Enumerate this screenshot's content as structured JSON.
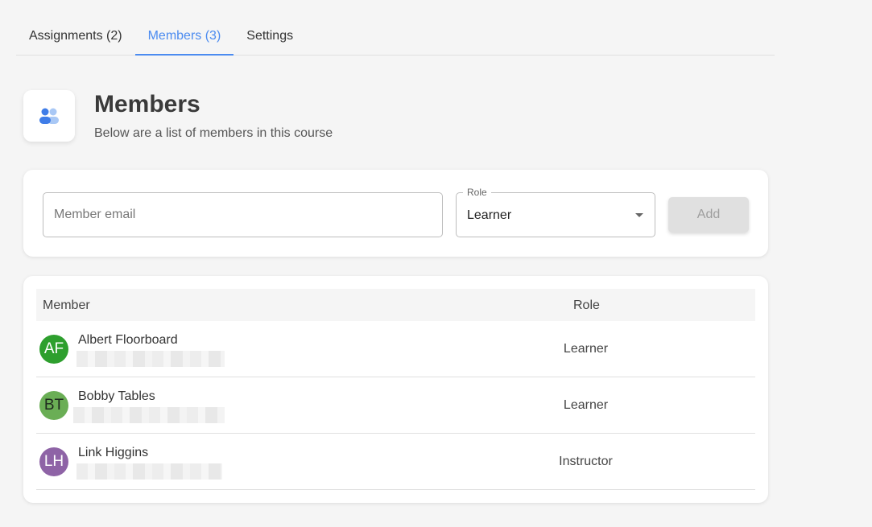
{
  "tabs": [
    {
      "label": "Assignments (2)",
      "active": false
    },
    {
      "label": "Members (3)",
      "active": true
    },
    {
      "label": "Settings",
      "active": false
    }
  ],
  "header": {
    "icon": "people-icon",
    "title": "Members",
    "subtitle": "Below are a list of members in this course"
  },
  "add_form": {
    "email_placeholder": "Member email",
    "email_value": "",
    "role_label": "Role",
    "role_value": "Learner",
    "add_label": "Add",
    "add_disabled": true
  },
  "table": {
    "columns": [
      "Member",
      "Role"
    ],
    "rows": [
      {
        "initials": "AF",
        "name": "Albert Floorboard",
        "role": "Learner",
        "avatar_color": "#2e9f2e"
      },
      {
        "initials": "BT",
        "name": "Bobby Tables",
        "role": "Learner",
        "avatar_color": "#6aae55"
      },
      {
        "initials": "LH",
        "name": "Link Higgins",
        "role": "Instructor",
        "avatar_color": "#8e63a6"
      }
    ]
  },
  "colors": {
    "accent": "#4b8bf0",
    "background": "#f5f5f5"
  }
}
